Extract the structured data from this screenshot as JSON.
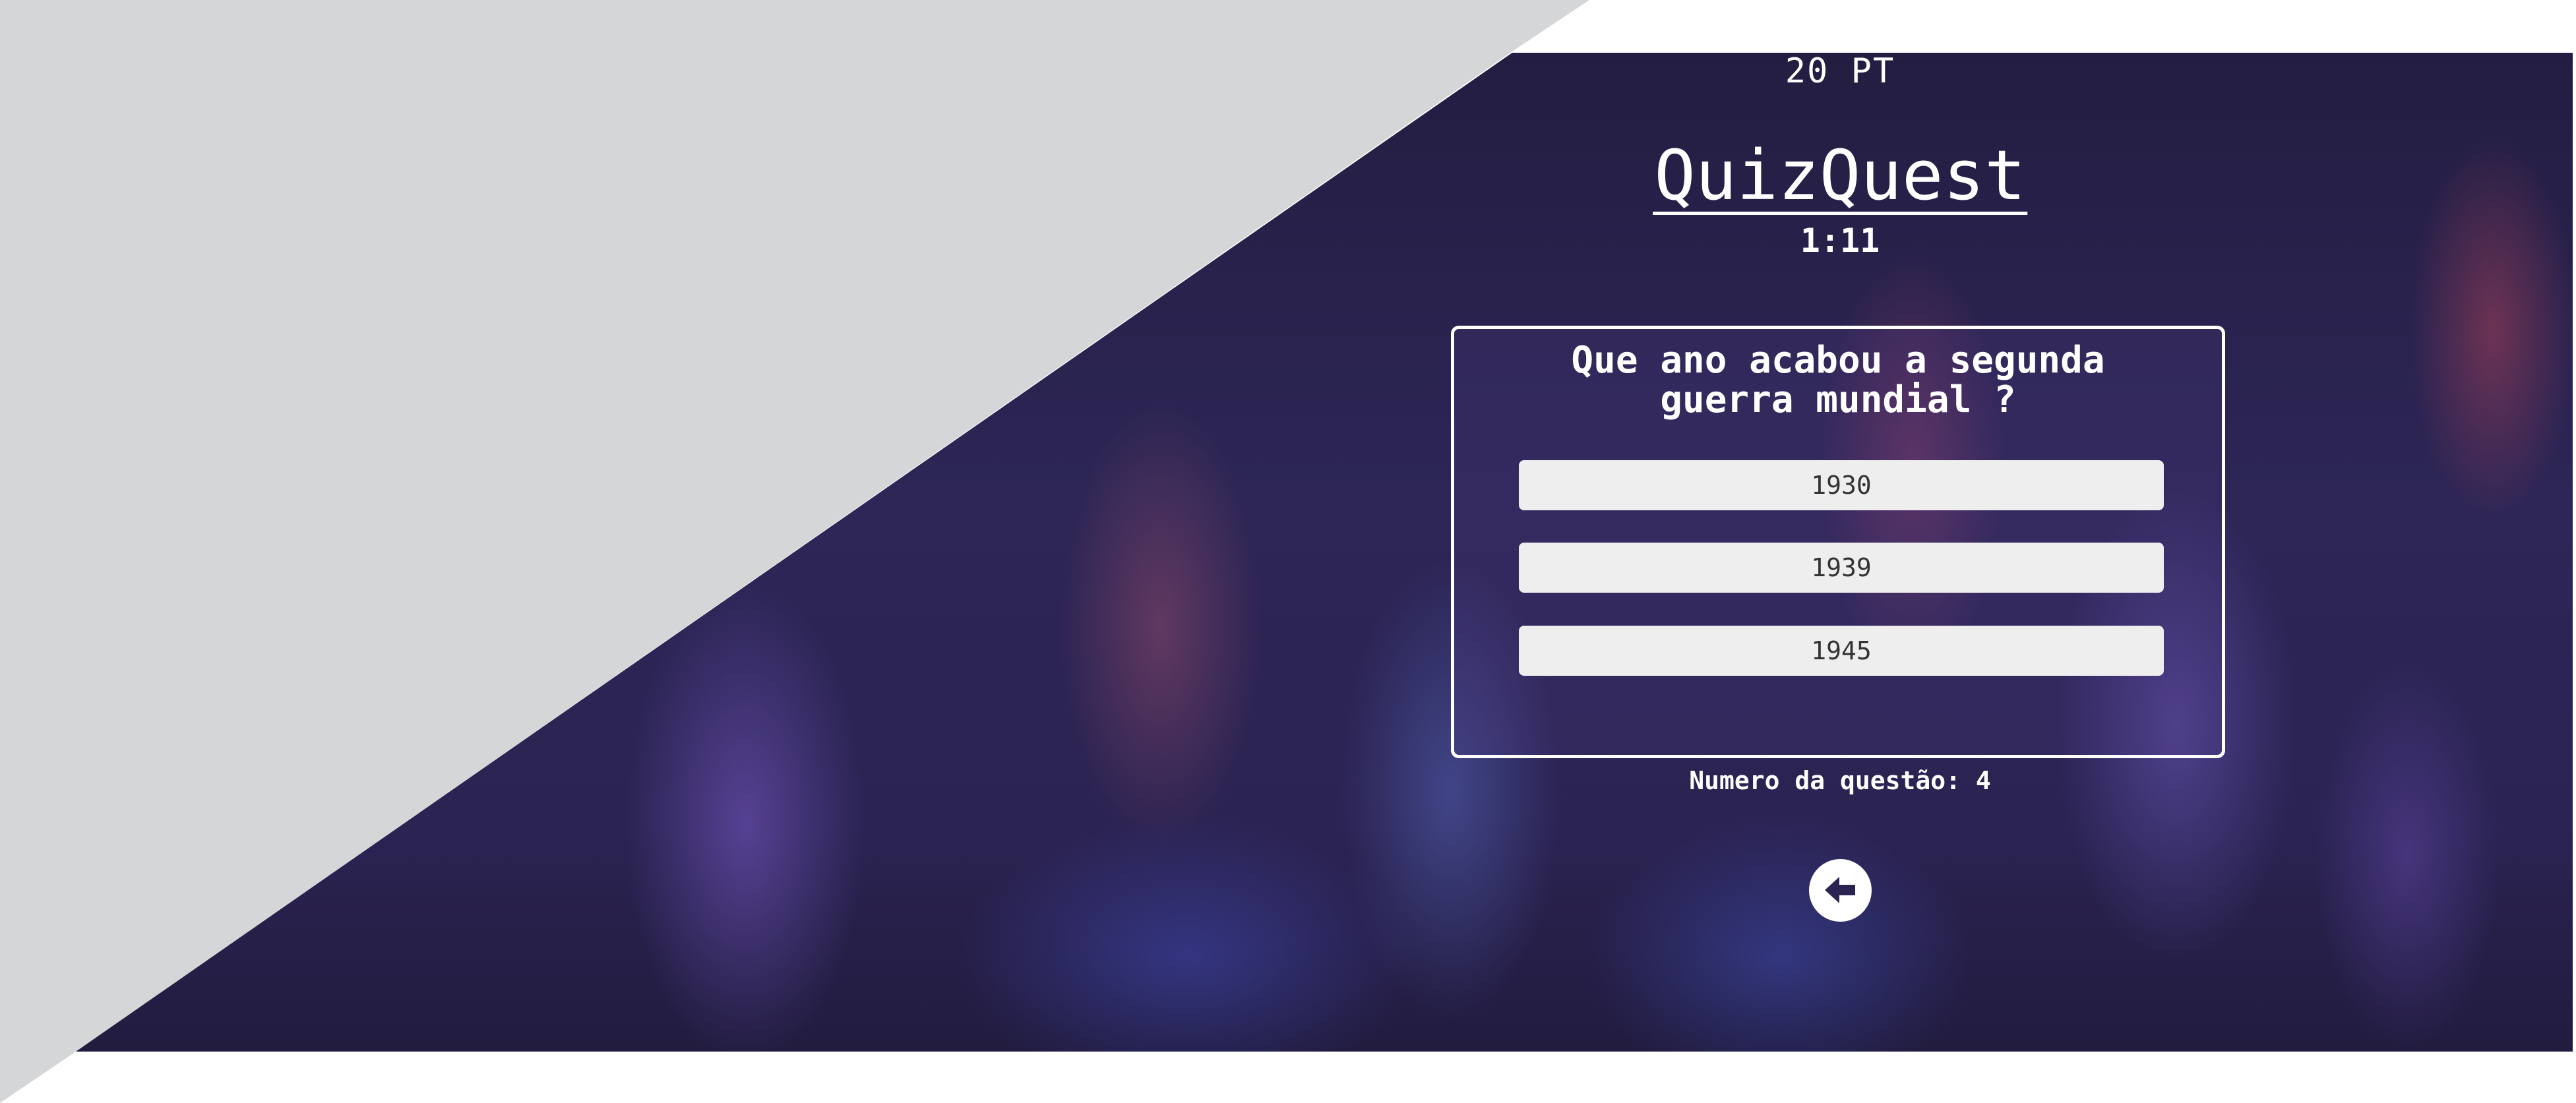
{
  "score": {
    "text": "20 PT"
  },
  "app": {
    "title": "QuizQuest"
  },
  "timer": {
    "text": "1:11"
  },
  "question": {
    "text": "Que ano acabou a segunda\nguerra mundial ?"
  },
  "answers": [
    {
      "label": "1930"
    },
    {
      "label": "1939"
    },
    {
      "label": "1945"
    }
  ],
  "question_number": {
    "text": "Numero da questão: 4"
  },
  "back_button": {
    "icon": "arrow-left-icon"
  },
  "colors": {
    "background_dark": "#2b2352",
    "grey_wedge": "#d5d6d8",
    "answer_bg": "#eeeeee",
    "text": "#ffffff"
  }
}
